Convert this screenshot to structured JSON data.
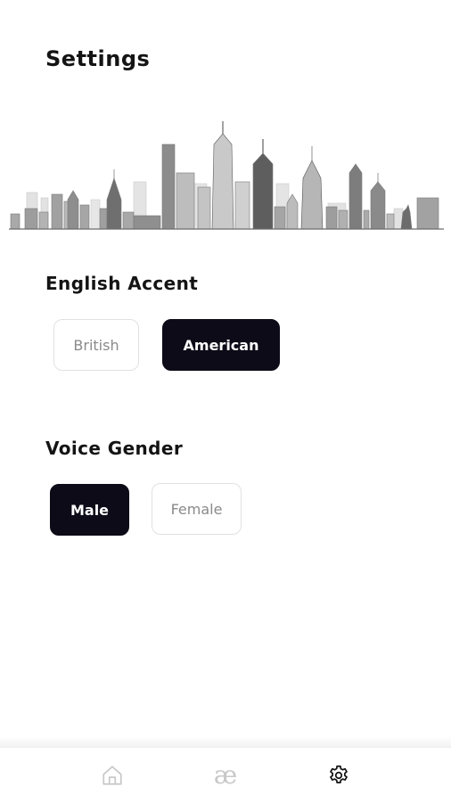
{
  "page": {
    "title": "Settings"
  },
  "accent": {
    "label": "English Accent",
    "options": [
      {
        "label": "British",
        "selected": false
      },
      {
        "label": "American",
        "selected": true
      }
    ]
  },
  "gender": {
    "label": "Voice Gender",
    "options": [
      {
        "label": "Male",
        "selected": true
      },
      {
        "label": "Female",
        "selected": false
      }
    ]
  },
  "nav": {
    "items": [
      {
        "icon": "home-icon",
        "active": false
      },
      {
        "icon": "ae-logo-icon",
        "glyph": "æ",
        "active": false
      },
      {
        "icon": "gear-icon",
        "active": true
      }
    ]
  },
  "colors": {
    "selected_bg": "#0c0b17",
    "selected_text": "#ffffff",
    "unselected_border": "#e1e1e1",
    "unselected_text": "#8a8a8a",
    "inactive_icon": "#c8c8c8",
    "active_icon": "#141414"
  }
}
